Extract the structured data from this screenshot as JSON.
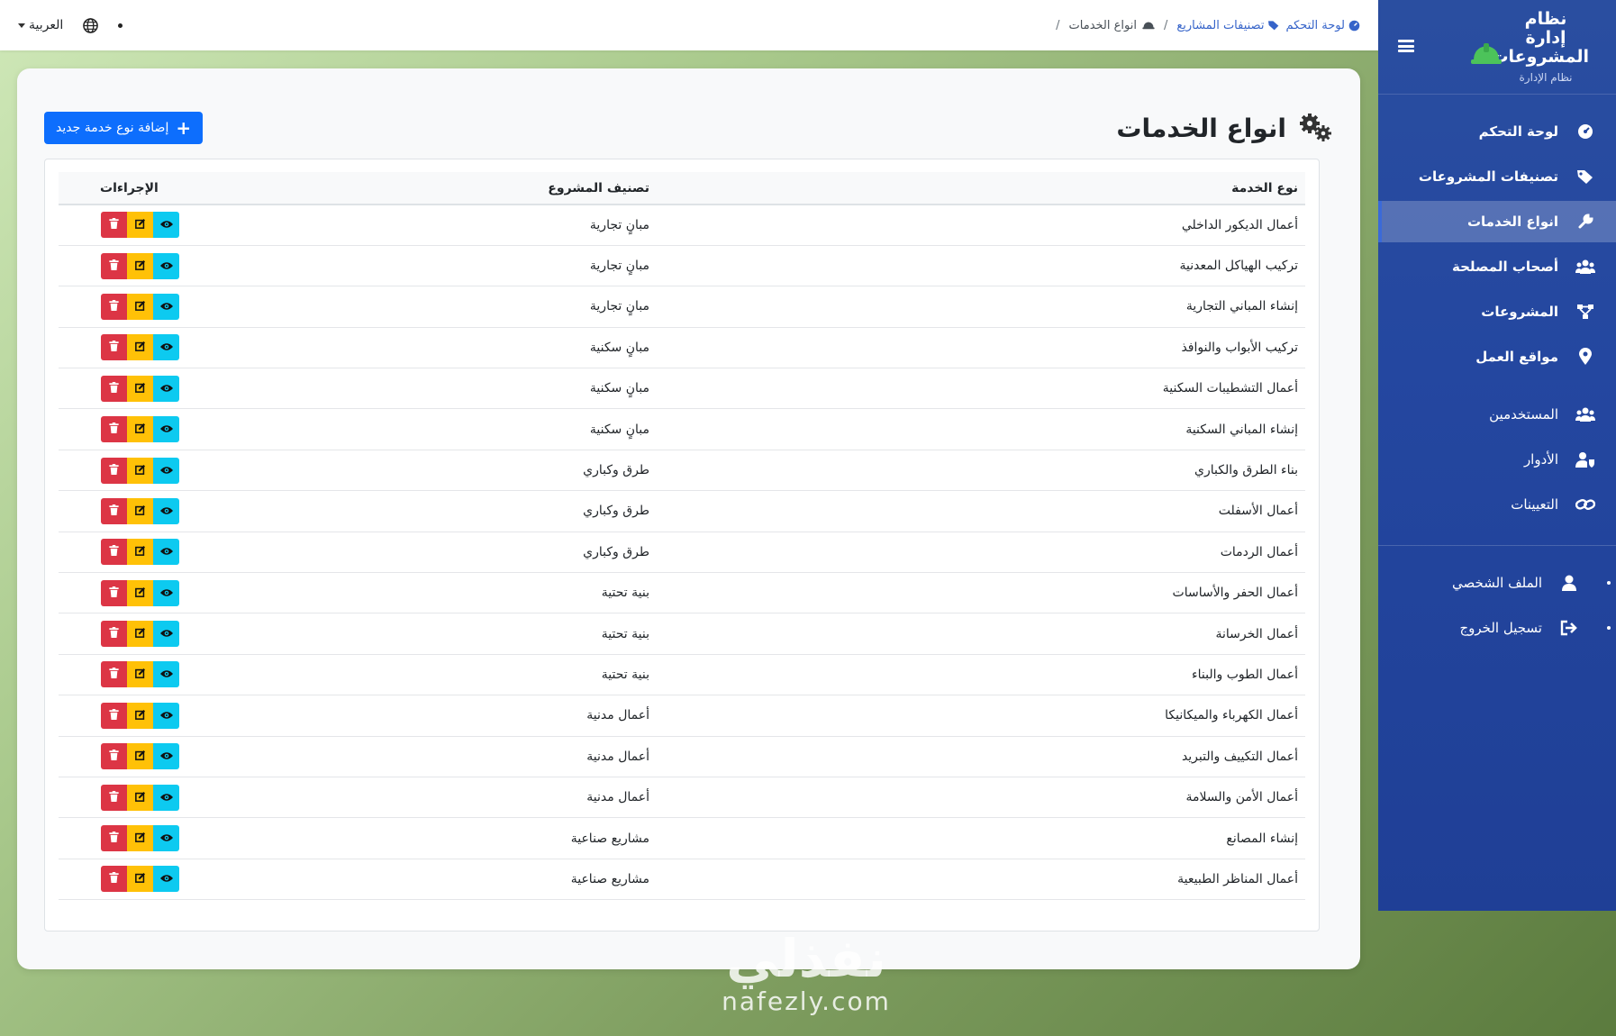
{
  "brand": {
    "title": "نظام إدارة المشروعات",
    "subtitle": "نظام الإدارة"
  },
  "sidebar": {
    "items": [
      {
        "label": "لوحة التحكم",
        "icon": "dashboard-icon"
      },
      {
        "label": "تصنيفات المشروعات",
        "icon": "tags-icon"
      },
      {
        "label": "انواع الخدمات",
        "icon": "wrench-icon",
        "active": true
      },
      {
        "label": "أصحاب المصلحة",
        "icon": "users-icon"
      },
      {
        "label": "المشروعات",
        "icon": "project-diagram-icon"
      },
      {
        "label": "مواقع العمل",
        "icon": "map-pin-icon"
      }
    ],
    "admin_items": [
      {
        "label": "المستخدمين",
        "icon": "users-icon"
      },
      {
        "label": "الأدوار",
        "icon": "user-shield-icon"
      },
      {
        "label": "التعيينات",
        "icon": "link-icon"
      }
    ],
    "user_items": [
      {
        "label": "الملف الشخصي",
        "icon": "user-icon"
      },
      {
        "label": "تسجيل الخروج",
        "icon": "sign-out-icon"
      }
    ]
  },
  "topbar": {
    "breadcrumb": [
      "لوحة التحكم",
      "تصنيفات المشاريع",
      "انواع الخدمات"
    ],
    "language": "العربية"
  },
  "page": {
    "title": "انواع الخدمات",
    "add_button": "إضافة نوع خدمة جديد"
  },
  "table": {
    "headers": {
      "type": "نوع الخدمة",
      "category": "تصنيف المشروع",
      "actions": "الإجراءات"
    },
    "rows": [
      {
        "type": "أعمال الديكور الداخلي",
        "category": "مبانٍ تجارية"
      },
      {
        "type": "تركيب الهياكل المعدنية",
        "category": "مبانٍ تجارية"
      },
      {
        "type": "إنشاء المباني التجارية",
        "category": "مبانٍ تجارية"
      },
      {
        "type": "تركيب الأبواب والنوافذ",
        "category": "مبانٍ سكنية"
      },
      {
        "type": "أعمال التشطيبات السكنية",
        "category": "مبانٍ سكنية"
      },
      {
        "type": "إنشاء المباني السكنية",
        "category": "مبانٍ سكنية"
      },
      {
        "type": "بناء الطرق والكباري",
        "category": "طرق وكباري"
      },
      {
        "type": "أعمال الأسفلت",
        "category": "طرق وكباري"
      },
      {
        "type": "أعمال الردمات",
        "category": "طرق وكباري"
      },
      {
        "type": "أعمال الحفر والأساسات",
        "category": "بنية تحتية"
      },
      {
        "type": "أعمال الخرسانة",
        "category": "بنية تحتية"
      },
      {
        "type": "أعمال الطوب والبناء",
        "category": "بنية تحتية"
      },
      {
        "type": "أعمال الكهرباء والميكانيكا",
        "category": "أعمال مدنية"
      },
      {
        "type": "أعمال التكييف والتبريد",
        "category": "أعمال مدنية"
      },
      {
        "type": "أعمال الأمن والسلامة",
        "category": "أعمال مدنية"
      },
      {
        "type": "إنشاء المصانع",
        "category": "مشاريع صناعية"
      },
      {
        "type": "أعمال المناظر الطبيعية",
        "category": "مشاريع صناعية"
      }
    ]
  },
  "watermark": {
    "arabic": "نفذلي",
    "latin": "nafezly.com"
  },
  "colors": {
    "sidebar": "#2447a0",
    "primary": "#0d6efd",
    "view": "#0dcaf0",
    "edit": "#ffc107",
    "delete": "#dc3545"
  }
}
